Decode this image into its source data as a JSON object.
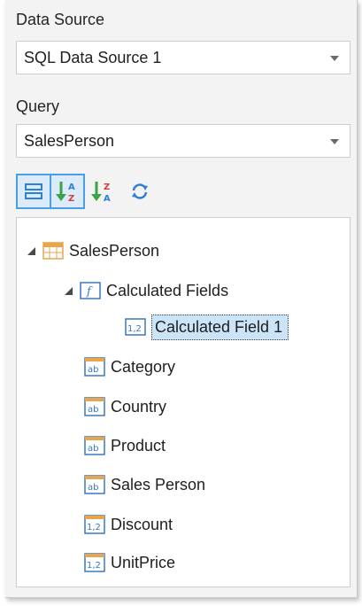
{
  "data_source": {
    "label": "Data Source",
    "value": "SQL Data Source 1"
  },
  "query": {
    "label": "Query",
    "value": "SalesPerson"
  },
  "toolbar": {
    "buttons": [
      {
        "icon": "group-fields-icon",
        "active": true
      },
      {
        "icon": "sort-ascending-icon",
        "active": true
      },
      {
        "icon": "sort-descending-icon",
        "active": false
      },
      {
        "icon": "refresh-icon",
        "active": false
      }
    ]
  },
  "tree": {
    "root": "SalesPerson",
    "calculated_group": "Calculated Fields",
    "calculated_fields": [
      {
        "label": "Calculated Field 1",
        "type": "numeric"
      }
    ],
    "fields": [
      {
        "label": "Category",
        "type": "string"
      },
      {
        "label": "Country",
        "type": "string"
      },
      {
        "label": "Product",
        "type": "string"
      },
      {
        "label": "Sales Person",
        "type": "string"
      },
      {
        "label": "Discount",
        "type": "numeric"
      },
      {
        "label": "UnitPrice",
        "type": "numeric"
      }
    ]
  },
  "colors": {
    "accent": "#4b9ee8",
    "selection": "#cce4f7",
    "field_icon_orange": "#e8a64a",
    "field_icon_blue": "#3a78c2"
  }
}
